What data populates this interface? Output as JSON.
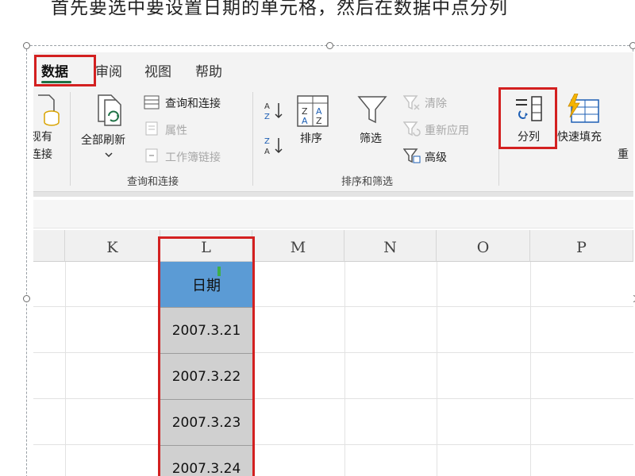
{
  "caption": "首先要选中要设置日期的单元格，然后在数据中点分列",
  "ribbon": {
    "tabs": [
      {
        "label": "数据",
        "active": true
      },
      {
        "label": "审阅",
        "active": false
      },
      {
        "label": "视图",
        "active": false
      },
      {
        "label": "帮助",
        "active": false
      }
    ],
    "cut_off_left": {
      "line1": "现有",
      "line2": "连接"
    },
    "refresh_all": "全部刷新",
    "query_connections": "查询和连接",
    "properties": "属性",
    "workbook_links": "工作簿链接",
    "group_query": "查询和连接",
    "sort": "排序",
    "filter": "筛选",
    "clear": "清除",
    "reapply": "重新应用",
    "advanced": "高级",
    "group_sort_filter": "排序和筛选",
    "text_to_columns": "分列",
    "flash_fill": "快速填充",
    "cut_off_right": "重"
  },
  "sheet": {
    "columns": [
      "K",
      "L",
      "M",
      "N",
      "O",
      "P"
    ],
    "header_cell": "日期",
    "dates": [
      "2007.3.21",
      "2007.3.22",
      "2007.3.23",
      "2007.3.24"
    ]
  },
  "colors": {
    "highlight": "#d32020",
    "header_fill": "#5b9bd5",
    "selection_fill": "#d0d0d0",
    "accent_green": "#1e7145"
  }
}
